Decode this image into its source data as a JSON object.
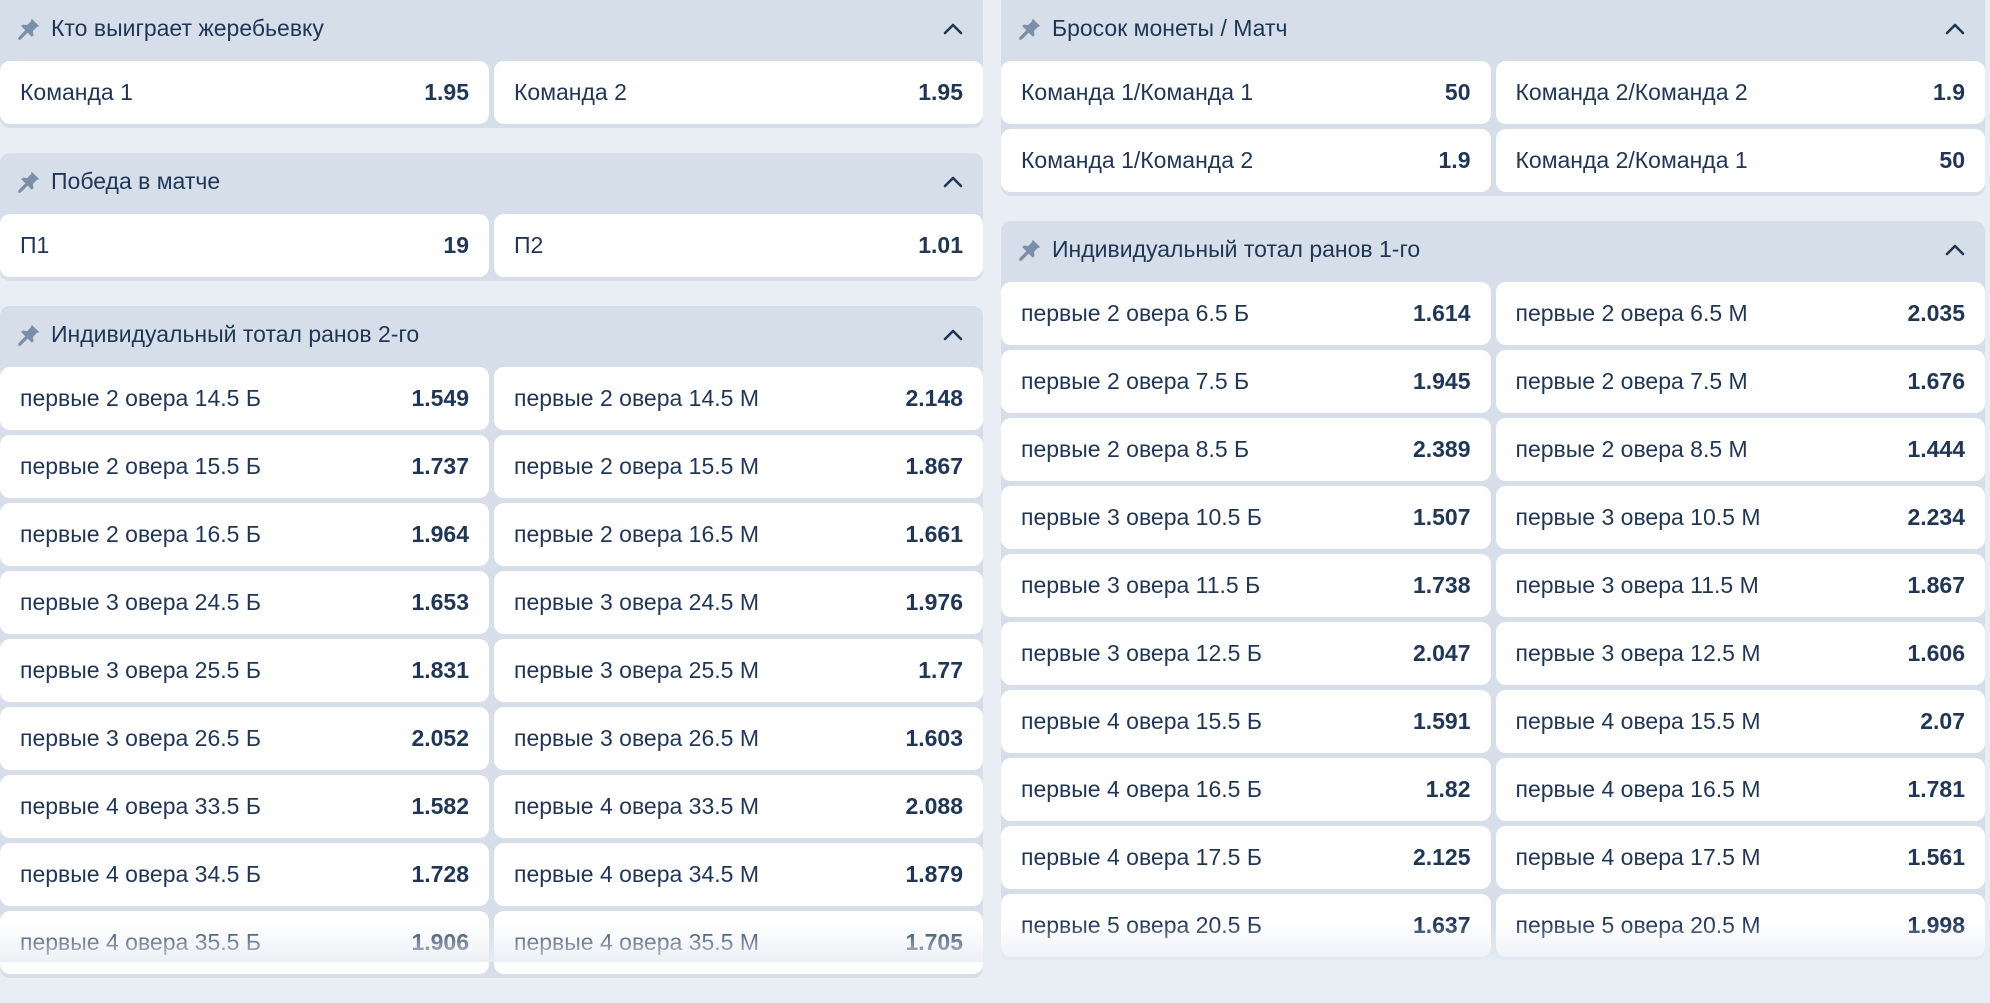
{
  "left": [
    {
      "title": "Кто выиграет жеребьевку",
      "rows": [
        [
          {
            "label": "Команда 1",
            "odd": "1.95"
          },
          {
            "label": "Команда 2",
            "odd": "1.95"
          }
        ]
      ]
    },
    {
      "title": "Победа в матче",
      "rows": [
        [
          {
            "label": "П1",
            "odd": "19"
          },
          {
            "label": "П2",
            "odd": "1.01"
          }
        ]
      ]
    },
    {
      "title": "Индивидуальный тотал ранов 2-го",
      "rows": [
        [
          {
            "label": "первые 2 овера 14.5 Б",
            "odd": "1.549"
          },
          {
            "label": "первые 2 овера 14.5 М",
            "odd": "2.148"
          }
        ],
        [
          {
            "label": "первые 2 овера 15.5 Б",
            "odd": "1.737"
          },
          {
            "label": "первые 2 овера 15.5 М",
            "odd": "1.867"
          }
        ],
        [
          {
            "label": "первые 2 овера 16.5 Б",
            "odd": "1.964"
          },
          {
            "label": "первые 2 овера 16.5 М",
            "odd": "1.661"
          }
        ],
        [
          {
            "label": "первые 3 овера 24.5 Б",
            "odd": "1.653"
          },
          {
            "label": "первые 3 овера 24.5 М",
            "odd": "1.976"
          }
        ],
        [
          {
            "label": "первые 3 овера 25.5 Б",
            "odd": "1.831"
          },
          {
            "label": "первые 3 овера 25.5 М",
            "odd": "1.77"
          }
        ],
        [
          {
            "label": "первые 3 овера 26.5 Б",
            "odd": "2.052"
          },
          {
            "label": "первые 3 овера 26.5 М",
            "odd": "1.603"
          }
        ],
        [
          {
            "label": "первые 4 овера 33.5 Б",
            "odd": "1.582"
          },
          {
            "label": "первые 4 овера 33.5 М",
            "odd": "2.088"
          }
        ],
        [
          {
            "label": "первые 4 овера 34.5 Б",
            "odd": "1.728"
          },
          {
            "label": "первые 4 овера 34.5 М",
            "odd": "1.879"
          }
        ],
        [
          {
            "label": "первые 4 овера 35.5 Б",
            "odd": "1.906"
          },
          {
            "label": "первые 4 овера 35.5 М",
            "odd": "1.705"
          }
        ]
      ]
    }
  ],
  "right": [
    {
      "title": "Бросок монеты / Матч",
      "rows": [
        [
          {
            "label": "Команда 1/Команда 1",
            "odd": "50"
          },
          {
            "label": "Команда 2/Команда 2",
            "odd": "1.9"
          }
        ],
        [
          {
            "label": "Команда 1/Команда 2",
            "odd": "1.9"
          },
          {
            "label": "Команда 2/Команда 1",
            "odd": "50"
          }
        ]
      ]
    },
    {
      "title": "Индивидуальный тотал ранов 1-го",
      "rows": [
        [
          {
            "label": "первые 2 овера 6.5 Б",
            "odd": "1.614"
          },
          {
            "label": "первые 2 овера 6.5 М",
            "odd": "2.035"
          }
        ],
        [
          {
            "label": "первые 2 овера 7.5 Б",
            "odd": "1.945"
          },
          {
            "label": "первые 2 овера 7.5 М",
            "odd": "1.676"
          }
        ],
        [
          {
            "label": "первые 2 овера 8.5 Б",
            "odd": "2.389"
          },
          {
            "label": "первые 2 овера 8.5 М",
            "odd": "1.444"
          }
        ],
        [
          {
            "label": "первые 3 овера 10.5 Б",
            "odd": "1.507"
          },
          {
            "label": "первые 3 овера 10.5 М",
            "odd": "2.234"
          }
        ],
        [
          {
            "label": "первые 3 овера 11.5 Б",
            "odd": "1.738"
          },
          {
            "label": "первые 3 овера 11.5 М",
            "odd": "1.867"
          }
        ],
        [
          {
            "label": "первые 3 овера 12.5 Б",
            "odd": "2.047"
          },
          {
            "label": "первые 3 овера 12.5 М",
            "odd": "1.606"
          }
        ],
        [
          {
            "label": "первые 4 овера 15.5 Б",
            "odd": "1.591"
          },
          {
            "label": "первые 4 овера 15.5 М",
            "odd": "2.07"
          }
        ],
        [
          {
            "label": "первые 4 овера 16.5 Б",
            "odd": "1.82"
          },
          {
            "label": "первые 4 овера 16.5 М",
            "odd": "1.781"
          }
        ],
        [
          {
            "label": "первые 4 овера 17.5 Б",
            "odd": "2.125"
          },
          {
            "label": "первые 4 овера 17.5 М",
            "odd": "1.561"
          }
        ],
        [
          {
            "label": "первые 5 овера 20.5 Б",
            "odd": "1.637"
          },
          {
            "label": "первые 5 овера 20.5 М",
            "odd": "1.998"
          }
        ]
      ]
    }
  ],
  "icons": {
    "pin": "pin-icon",
    "collapse": "chevron-up-icon"
  },
  "colors": {
    "panel": "#d5dee9",
    "cell": "#ffffff",
    "text": "#1f3656",
    "page": "#e9eef4"
  }
}
